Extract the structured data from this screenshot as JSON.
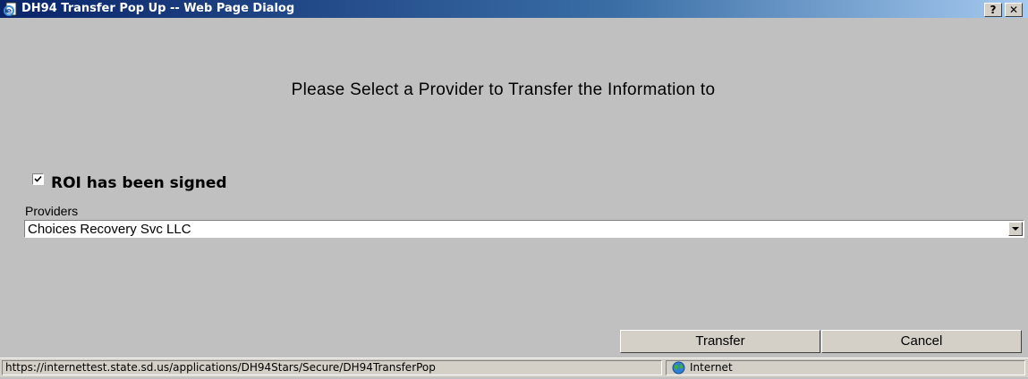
{
  "window": {
    "title": "DH94 Transfer Pop Up -- Web Page Dialog",
    "help_label": "?",
    "close_label": "✕"
  },
  "main": {
    "heading": "Please Select a Provider to Transfer the Information to",
    "roi": {
      "label": "ROI has been signed",
      "checked": true
    },
    "providers": {
      "label": "Providers",
      "selected": "Choices Recovery Svc LLC"
    },
    "buttons": {
      "transfer": "Transfer",
      "cancel": "Cancel"
    }
  },
  "statusbar": {
    "url": "https://internettest.state.sd.us/applications/DH94Stars/Secure/DH94TransferPop",
    "zone": "Internet"
  },
  "icons": {
    "title": "ie-page-icon",
    "checkbox": "check-icon",
    "dropdown": "chevron-down-icon",
    "zone": "globe-icon"
  }
}
